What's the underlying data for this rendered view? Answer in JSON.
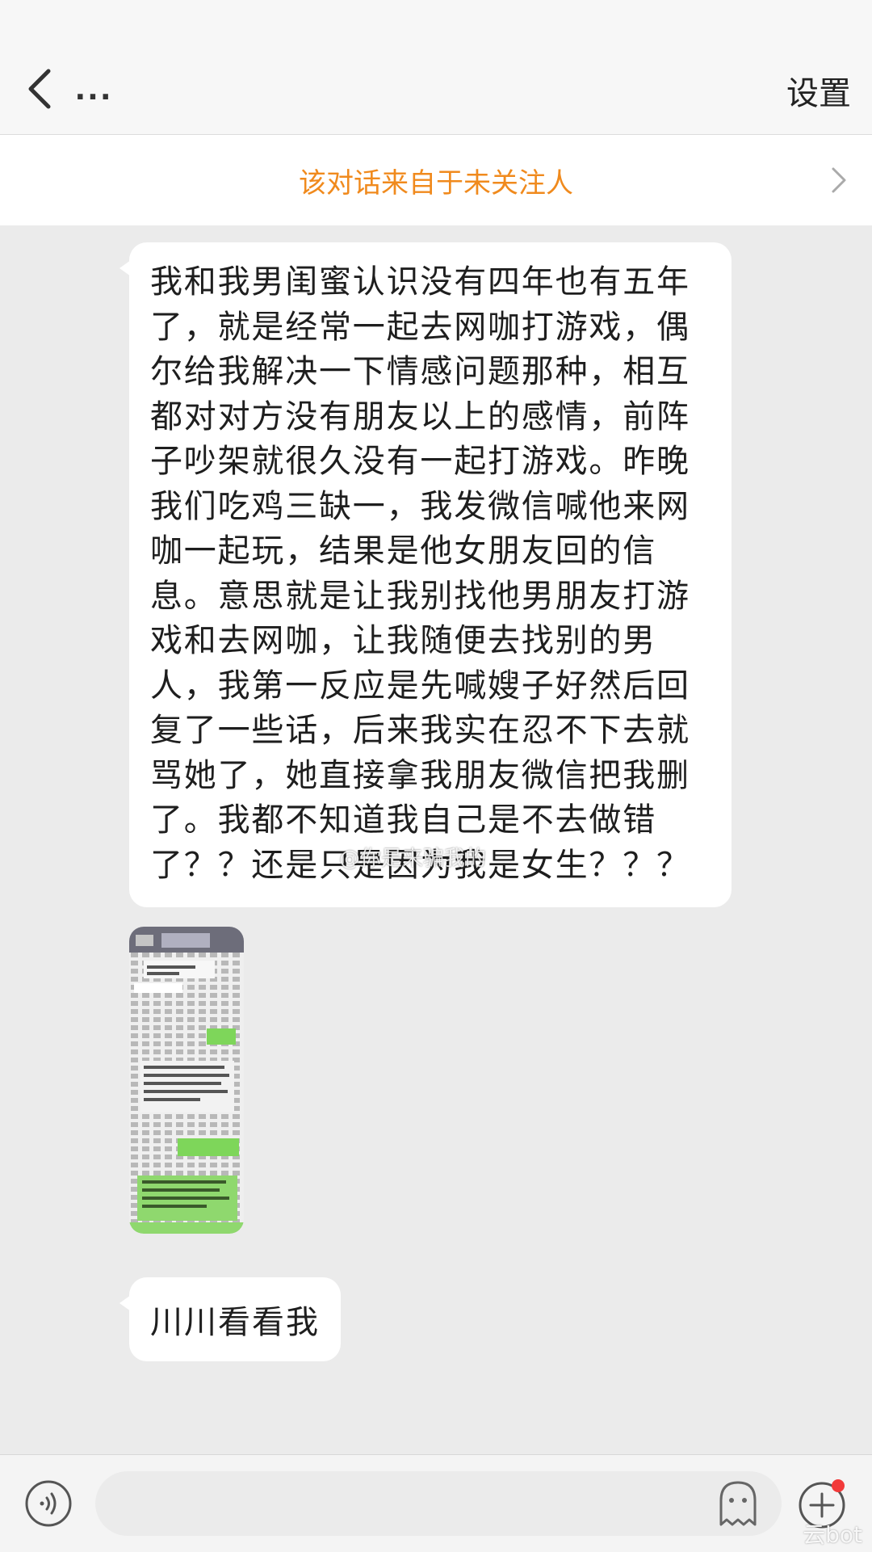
{
  "header": {
    "more_label": "...",
    "settings_label": "设置"
  },
  "notice": {
    "text": "该对话来自于未关注人"
  },
  "messages": {
    "first_lines": [
      "我和我男闺蜜认识没有四年也有五年",
      "了，就是经常一起去网咖打游戏，偶",
      "尔给我解决一下情感问题那种，相互",
      "都对对方没有朋友以上的感情，前阵",
      "子吵架就很久没有一起打游戏。昨晚",
      "我们吃鸡三缺一，我发微信喊他来网",
      "咖一起玩，结果是他女朋友回的信",
      "息。意思就是让我别找他男朋友打游",
      "戏和去网咖，让我随便去找别的男",
      "人，我第一反应是先喊嫂子好然后回",
      "复了一些话，后来我实在忍不下去就",
      "骂她了，她直接拿我朋友微信把我删",
      "了。我都不知道我自己是不去做错",
      "了？？还是只是因为我是女生？？？"
    ],
    "second": "川川看看我"
  },
  "watermarks": {
    "center": "@你是来骗我的",
    "corner": "云bot"
  },
  "colors": {
    "notice_orange": "#f08a1d",
    "chat_bg": "#ebebeb",
    "bubble_bg": "#ffffff",
    "badge_red": "#f23a3a",
    "chat_green": "#7ed65a"
  }
}
